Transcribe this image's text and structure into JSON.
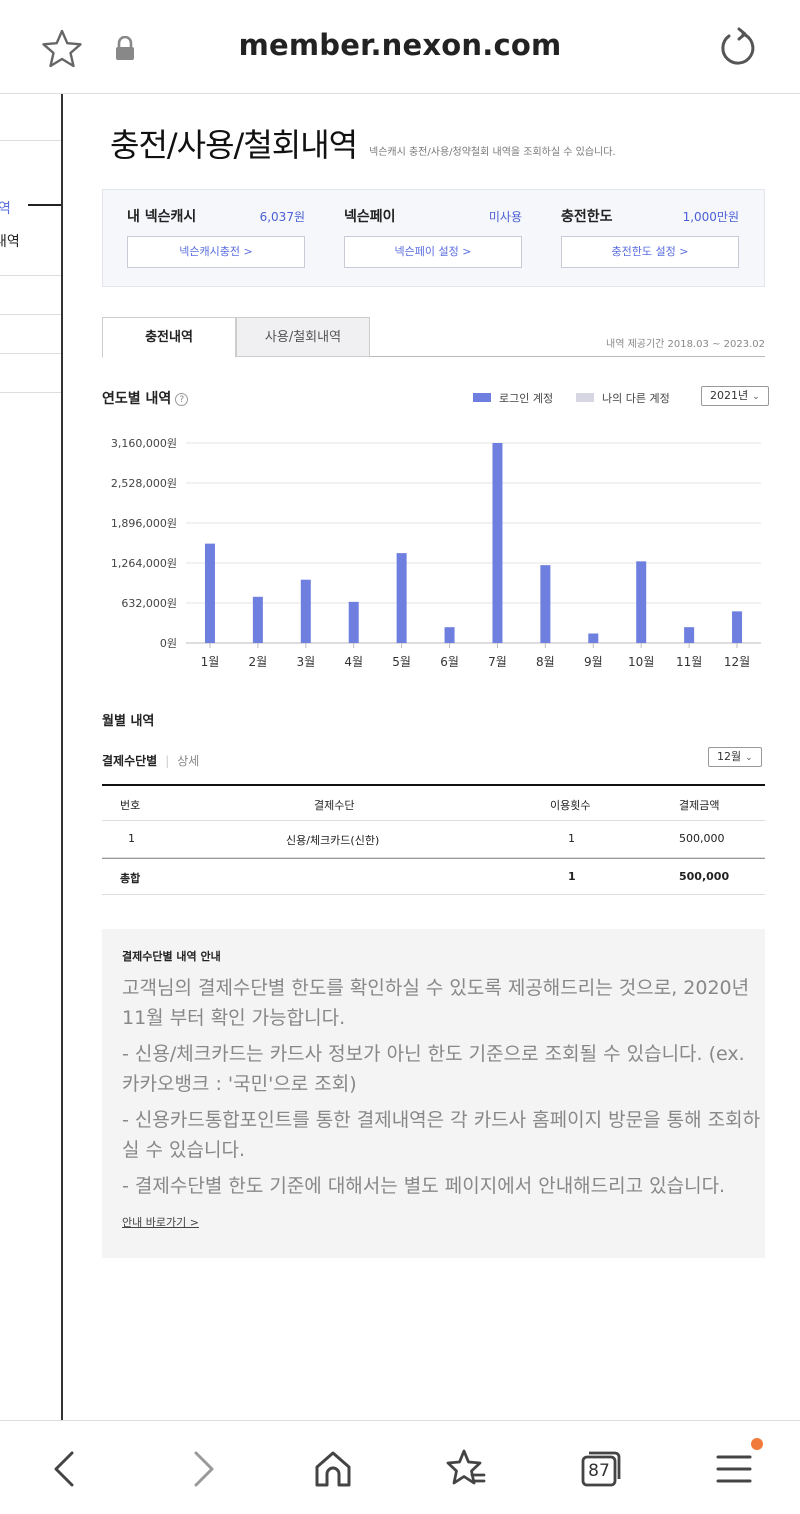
{
  "browser": {
    "url": "member.nexon.com",
    "tab_count": "87"
  },
  "sidebar": {
    "items": [
      {
        "label": "역",
        "active": true
      },
      {
        "label": "내역",
        "active": false
      }
    ]
  },
  "page": {
    "title": "충전/사용/철회내역",
    "subtitle": "넥슨캐시 충전/사용/청약철회 내역을 조회하실 수 있습니다."
  },
  "cash_summary": [
    {
      "label": "내 넥슨캐시",
      "value": "6,037원",
      "button": "넥슨캐시충전 >"
    },
    {
      "label": "넥슨페이",
      "value": "미사용",
      "button": "넥슨페이 설정 >"
    },
    {
      "label": "충전한도",
      "value": "1,000만원",
      "button": "충전한도 설정 >"
    }
  ],
  "tabs": [
    "충전내역",
    "사용/철회내역"
  ],
  "period": "내역 제공기간 2018.03 ~ 2023.02",
  "yearly": {
    "title": "연도별 내역",
    "help": "?",
    "legend": [
      "로그인 계정",
      "나의 다른 계정"
    ],
    "year_select": "2021년"
  },
  "chart_data": {
    "type": "bar",
    "categories": [
      "1월",
      "2월",
      "3월",
      "4월",
      "5월",
      "6월",
      "7월",
      "8월",
      "9월",
      "10월",
      "11월",
      "12월"
    ],
    "series": [
      {
        "name": "로그인 계정",
        "values": [
          1570000,
          730000,
          1000000,
          650000,
          1420000,
          250000,
          3160000,
          1230000,
          150000,
          1290000,
          250000,
          500000
        ]
      },
      {
        "name": "나의 다른 계정",
        "values": [
          0,
          0,
          0,
          0,
          0,
          0,
          0,
          0,
          0,
          0,
          0,
          0
        ]
      }
    ],
    "yticks": [
      "0원",
      "632,000원",
      "1,264,000원",
      "1,896,000원",
      "2,528,000원",
      "3,160,000원"
    ],
    "ylim": [
      0,
      3160000
    ],
    "colors": {
      "login": "#6f7fe0",
      "other": "#d6d7e2"
    }
  },
  "monthly": {
    "title": "월별 내역",
    "subtab_active": "결제수단별",
    "subtab_other": "상세",
    "month_select": "12월",
    "headers": [
      "번호",
      "결제수단",
      "이용횟수",
      "결제금액"
    ],
    "rows": [
      {
        "no": "1",
        "method": "신용/체크카드(신한)",
        "count": "1",
        "amount": "500,000"
      }
    ],
    "total": {
      "label": "총합",
      "count": "1",
      "amount": "500,000"
    }
  },
  "notice": {
    "title": "결제수단별 내역 안내",
    "lines": [
      "고객님의 결제수단별 한도를 확인하실 수 있도록 제공해드리는 것으로, 2020년 11월 부터 확인 가능합니다.",
      "- 신용/체크카드는 카드사 정보가 아닌 한도 기준으로 조회될 수 있습니다. (ex. 카카오뱅크 : '국민'으로 조회)",
      "- 신용카드통합포인트를 통한 결제내역은 각 카드사 홈페이지 방문을 통해 조회하실 수 있습니다.",
      "- 결제수단별 한도 기준에 대해서는 별도 페이지에서 안내해드리고 있습니다."
    ],
    "link": "안내 바로가기 >"
  }
}
